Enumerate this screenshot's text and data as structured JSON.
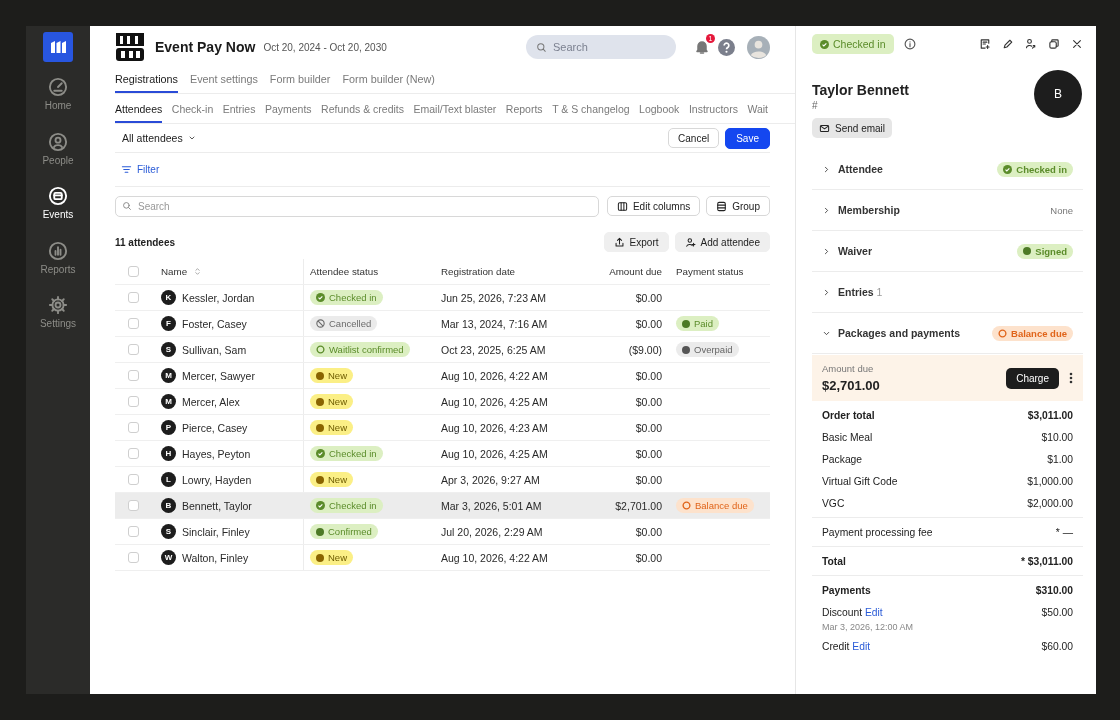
{
  "nav": {
    "items": [
      {
        "label": "Home",
        "kind": "gauge",
        "selected": false
      },
      {
        "label": "People",
        "kind": "person",
        "selected": false
      },
      {
        "label": "Events",
        "kind": "calendar",
        "selected": true
      },
      {
        "label": "Reports",
        "kind": "chart",
        "selected": false
      },
      {
        "label": "Settings",
        "kind": "gear",
        "selected": false
      }
    ]
  },
  "header": {
    "title": "Event Pay Now",
    "dates": "Oct 20, 2024 - Oct 20, 2030",
    "search": {
      "placeholder": "Search"
    },
    "notifications": "1"
  },
  "tabs": [
    {
      "label": "Registrations",
      "selected": true
    },
    {
      "label": "Event settings",
      "selected": false
    },
    {
      "label": "Form builder",
      "selected": false
    },
    {
      "label": "Form builder (New)",
      "selected": false
    }
  ],
  "subtabs": [
    {
      "label": "Attendees",
      "selected": true
    },
    {
      "label": "Check-in",
      "selected": false
    },
    {
      "label": "Entries",
      "selected": false
    },
    {
      "label": "Payments",
      "selected": false
    },
    {
      "label": "Refunds & credits",
      "selected": false
    },
    {
      "label": "Email/Text blaster",
      "selected": false
    },
    {
      "label": "Reports",
      "selected": false
    },
    {
      "label": "T & S changelog",
      "selected": false
    },
    {
      "label": "Logbook",
      "selected": false
    },
    {
      "label": "Instructors",
      "selected": false
    },
    {
      "label": "Wait",
      "selected": false
    }
  ],
  "toolbar": {
    "view": "All attendees",
    "cancel": "Cancel",
    "save": "Save",
    "filter": "Filter",
    "search": {
      "placeholder": "Search"
    },
    "edit_columns": "Edit columns",
    "group": "Group",
    "count": "11 attendees",
    "export": "Export",
    "add": "Add attendee"
  },
  "table": {
    "select_all": {
      "checked": false
    },
    "columns": [
      "Name",
      "Attendee status",
      "Registration date",
      "Amount due",
      "Payment status"
    ],
    "rows": [
      {
        "initial": "K",
        "name": "Kessler, Jordan",
        "status": {
          "label": "Checked in",
          "kind": "checked"
        },
        "date": "Jun 25, 2026, 7:23 AM",
        "amount": "$0.00",
        "checked": false,
        "selected": false
      },
      {
        "initial": "F",
        "name": "Foster, Casey",
        "status": {
          "label": "Cancelled",
          "kind": "cancelled"
        },
        "date": "Mar 13, 2024, 7:16 AM",
        "amount": "$0.00",
        "payment": {
          "label": "Paid",
          "kind": "paid"
        },
        "checked": false,
        "selected": false
      },
      {
        "initial": "S",
        "name": "Sullivan, Sam",
        "status": {
          "label": "Waitlist confirmed",
          "kind": "waitlist"
        },
        "date": "Oct 23, 2025, 6:25 AM",
        "amount": "($9.00)",
        "payment": {
          "label": "Overpaid",
          "kind": "overpaid"
        },
        "checked": false,
        "selected": false
      },
      {
        "initial": "M",
        "name": "Mercer, Sawyer",
        "status": {
          "label": "New",
          "kind": "new"
        },
        "date": "Aug 10, 2026, 4:22 AM",
        "amount": "$0.00",
        "checked": false,
        "selected": false
      },
      {
        "initial": "M",
        "name": "Mercer, Alex",
        "status": {
          "label": "New",
          "kind": "new"
        },
        "date": "Aug 10, 2026, 4:25 AM",
        "amount": "$0.00",
        "checked": false,
        "selected": false
      },
      {
        "initial": "P",
        "name": "Pierce, Casey",
        "status": {
          "label": "New",
          "kind": "new"
        },
        "date": "Aug 10, 2026, 4:23 AM",
        "amount": "$0.00",
        "checked": false,
        "selected": false
      },
      {
        "initial": "H",
        "name": "Hayes, Peyton",
        "status": {
          "label": "Checked in",
          "kind": "checked"
        },
        "date": "Aug 10, 2026, 4:25 AM",
        "amount": "$0.00",
        "checked": false,
        "selected": false
      },
      {
        "initial": "L",
        "name": "Lowry, Hayden",
        "status": {
          "label": "New",
          "kind": "new"
        },
        "date": "Apr 3, 2026, 9:27 AM",
        "amount": "$0.00",
        "checked": false,
        "selected": false
      },
      {
        "initial": "B",
        "name": "Bennett, Taylor",
        "status": {
          "label": "Checked in",
          "kind": "checked"
        },
        "date": "Mar 3, 2026, 5:01 AM",
        "amount": "$2,701.00",
        "payment": {
          "label": "Balance due",
          "kind": "balance"
        },
        "checked": false,
        "selected": true
      },
      {
        "initial": "S",
        "name": "Sinclair, Finley",
        "status": {
          "label": "Confirmed",
          "kind": "confirmed"
        },
        "date": "Jul 20, 2026, 2:29 AM",
        "amount": "$0.00",
        "checked": false,
        "selected": false
      },
      {
        "initial": "W",
        "name": "Walton, Finley",
        "status": {
          "label": "New",
          "kind": "new"
        },
        "date": "Aug 10, 2026, 4:22 AM",
        "amount": "$0.00",
        "checked": false,
        "selected": false
      }
    ]
  },
  "panel": {
    "status": {
      "label": "Checked in",
      "kind": "checked"
    },
    "name": "Taylor Bennett",
    "number": "#",
    "initial": "B",
    "send_email": "Send email",
    "sections": [
      {
        "label": "Attendee",
        "kind": "badge",
        "expanded": false,
        "badge": {
          "label": "Checked in",
          "kind": "checked"
        }
      },
      {
        "label": "Membership",
        "kind": "value",
        "expanded": false,
        "value": "None"
      },
      {
        "label": "Waiver",
        "kind": "badge",
        "expanded": false,
        "badge": {
          "label": "Signed",
          "kind": "confirmed"
        }
      },
      {
        "label": "Entries",
        "kind": "count",
        "expanded": false,
        "count": "1"
      },
      {
        "label": "Packages and payments",
        "kind": "badge",
        "expanded": true,
        "badge": {
          "label": "Balance due",
          "kind": "balance"
        }
      }
    ],
    "amount_due": {
      "label": "Amount due",
      "value": "$2,701.00",
      "action": "Charge"
    },
    "groups": [
      [
        {
          "kind": "total",
          "label": "Order total",
          "value": "$3,011.00"
        },
        {
          "kind": "item",
          "label": "Basic Meal",
          "value": "$10.00"
        },
        {
          "kind": "item",
          "label": "Package",
          "value": "$1.00"
        },
        {
          "kind": "item",
          "label": "Virtual Gift Code",
          "value": "$1,000.00"
        },
        {
          "kind": "item",
          "label": "VGC",
          "value": "$2,000.00"
        }
      ],
      [
        {
          "kind": "item",
          "label": "Payment processing fee",
          "value": "* —"
        }
      ],
      [
        {
          "kind": "total",
          "label": "Total",
          "value": "* $3,011.00"
        }
      ],
      [
        {
          "kind": "total",
          "label": "Payments",
          "value": "$310.00"
        },
        {
          "kind": "payment",
          "label": "Discount",
          "link": "Edit",
          "date": "Mar 3, 2026, 12:00 AM",
          "value": "$50.00"
        },
        {
          "kind": "payment",
          "label": "Credit",
          "link": "Edit",
          "value": "$60.00"
        }
      ]
    ]
  }
}
